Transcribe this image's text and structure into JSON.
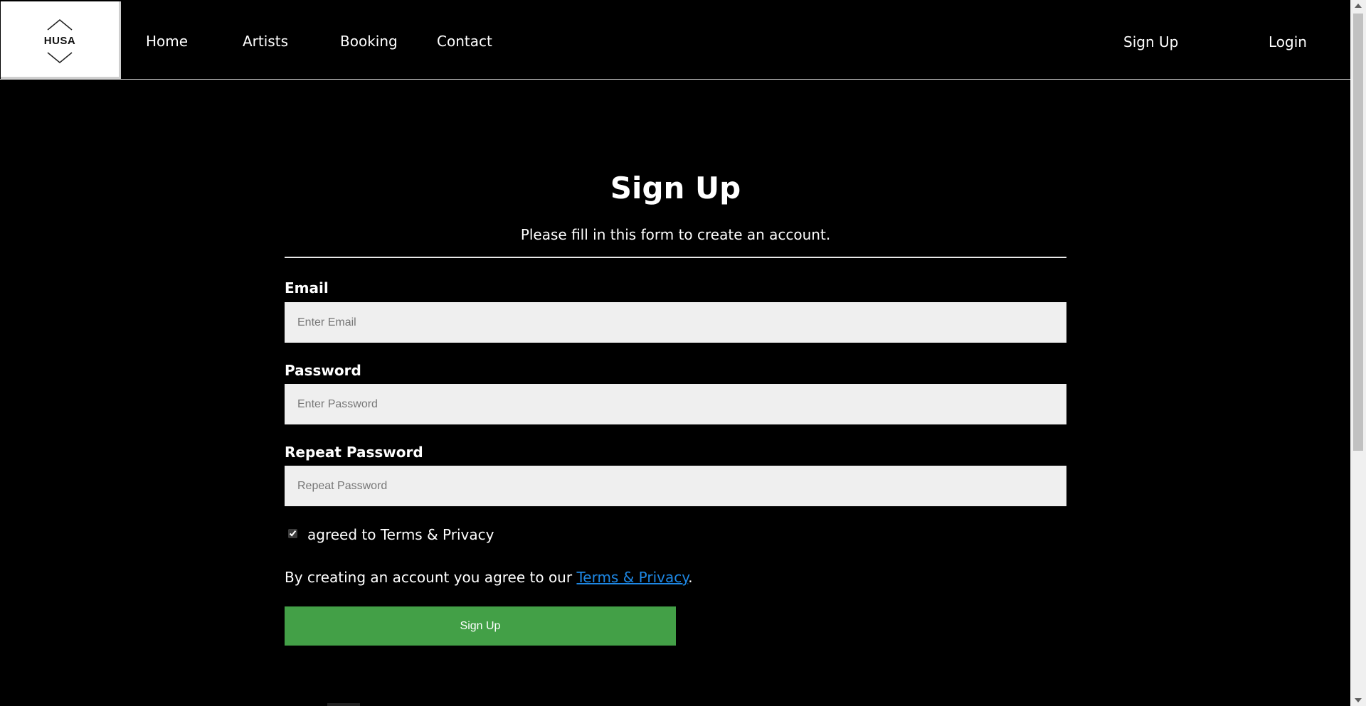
{
  "logo": {
    "text": "HUSA"
  },
  "nav": {
    "left_items": [
      {
        "label": "Home"
      },
      {
        "label": "Artists"
      },
      {
        "label": "Booking"
      },
      {
        "label": "Contact"
      }
    ],
    "right_items": [
      {
        "label": "Sign Up"
      },
      {
        "label": "Login"
      }
    ]
  },
  "form": {
    "title": "Sign Up",
    "subtitle": "Please fill in this form to create an account.",
    "email_label": "Email",
    "email_placeholder": "Enter Email",
    "email_value": "",
    "password_label": "Password",
    "password_placeholder": "Enter Password",
    "password_value": "",
    "repeat_label": "Repeat Password",
    "repeat_placeholder": "Repeat Password",
    "repeat_value": "",
    "checkbox_label": "agreed to Terms & Privacy",
    "checkbox_checked": true,
    "agree_prefix": "By creating an account you agree to our ",
    "agree_link": "Terms & Privacy",
    "agree_suffix": ".",
    "submit_label": "Sign Up"
  },
  "colors": {
    "background": "#000000",
    "input_background": "#efefef",
    "button_green": "#43a047",
    "link_blue": "#1e88e5"
  }
}
